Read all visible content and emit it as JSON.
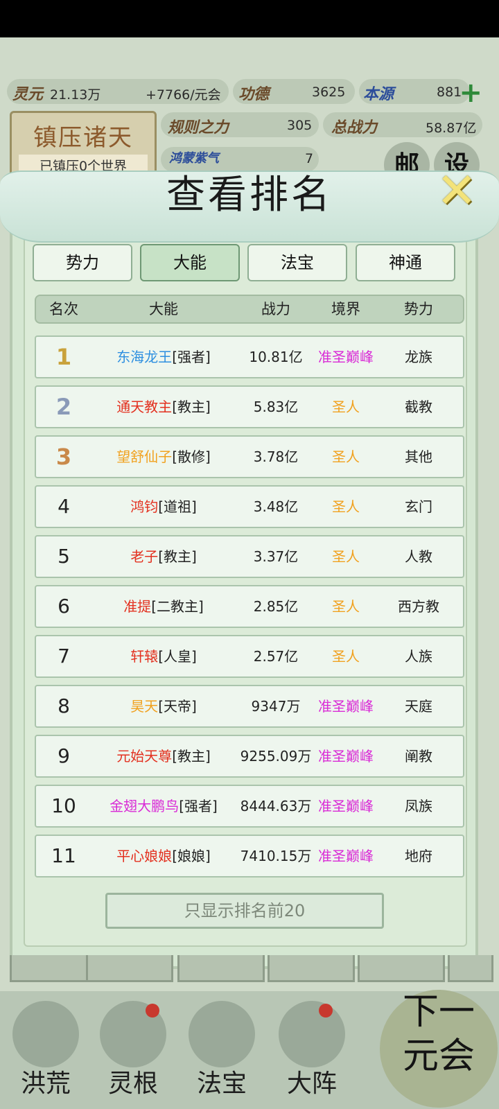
{
  "hud": {
    "lingyuan_label": "灵元",
    "lingyuan_value": "21.13万",
    "lingyuan_rate": "+7766/元会",
    "gongde_label": "功德",
    "gongde_value": "3625",
    "benyuan_label": "本源",
    "benyuan_value": "881",
    "guize_label": "规则之力",
    "guize_value": "305",
    "zhanli_label": "总战力",
    "zhanli_value": "58.87亿",
    "hongmeng_label": "鸿蒙紫气",
    "hongmeng_value": "7",
    "suppress_title": "镇压诸天",
    "suppress_sub": "已镇压0个世界",
    "mail_label": "邮",
    "settings_label": "设"
  },
  "dialog": {
    "title": "查看排名",
    "tabs": [
      "势力",
      "大能",
      "法宝",
      "神通"
    ],
    "active_tab": "大能",
    "headers": [
      "名次",
      "大能",
      "战力",
      "境界",
      "势力"
    ],
    "rows": [
      {
        "rank": "1",
        "name": "东海龙王",
        "title": "[强者]",
        "power": "10.81亿",
        "realm": "准圣巅峰",
        "faction": "龙族",
        "name_color": "#2e8fe0",
        "rank_color": "#c9a23c"
      },
      {
        "rank": "2",
        "name": "通天教主",
        "title": "[教主]",
        "power": "5.83亿",
        "realm": "圣人",
        "faction": "截教",
        "name_color": "#e3301f",
        "rank_color": "#8a9ab8"
      },
      {
        "rank": "3",
        "name": "望舒仙子",
        "title": "[散修]",
        "power": "3.78亿",
        "realm": "圣人",
        "faction": "其他",
        "name_color": "#f1a11f",
        "rank_color": "#c9894a"
      },
      {
        "rank": "4",
        "name": "鸿钧",
        "title": "[道祖]",
        "power": "3.48亿",
        "realm": "圣人",
        "faction": "玄门",
        "name_color": "#e3301f",
        "rank_color": "#222222"
      },
      {
        "rank": "5",
        "name": "老子",
        "title": "[教主]",
        "power": "3.37亿",
        "realm": "圣人",
        "faction": "人教",
        "name_color": "#e3301f",
        "rank_color": "#222222"
      },
      {
        "rank": "6",
        "name": "准提",
        "title": "[二教主]",
        "power": "2.85亿",
        "realm": "圣人",
        "faction": "西方教",
        "name_color": "#e3301f",
        "rank_color": "#222222"
      },
      {
        "rank": "7",
        "name": "轩辕",
        "title": "[人皇]",
        "power": "2.57亿",
        "realm": "圣人",
        "faction": "人族",
        "name_color": "#e3301f",
        "rank_color": "#222222"
      },
      {
        "rank": "8",
        "name": "昊天",
        "title": "[天帝]",
        "power": "9347万",
        "realm": "准圣巅峰",
        "faction": "天庭",
        "name_color": "#f1a11f",
        "rank_color": "#222222"
      },
      {
        "rank": "9",
        "name": "元始天尊",
        "title": "[教主]",
        "power": "9255.09万",
        "realm": "准圣巅峰",
        "faction": "阐教",
        "name_color": "#e3301f",
        "rank_color": "#222222"
      },
      {
        "rank": "10",
        "name": "金翅大鹏鸟",
        "title": "[强者]",
        "power": "8444.63万",
        "realm": "准圣巅峰",
        "faction": "凤族",
        "name_color": "#d92ad6",
        "rank_color": "#222222"
      },
      {
        "rank": "11",
        "name": "平心娘娘",
        "title": "[娘娘]",
        "power": "7410.15万",
        "realm": "准圣巅峰",
        "faction": "地府",
        "name_color": "#e3301f",
        "rank_color": "#222222"
      }
    ],
    "bottom_button": "只显示排名前20"
  },
  "nav": {
    "items": [
      "洪荒",
      "灵根",
      "法宝",
      "大阵"
    ],
    "next_label_1": "下一",
    "next_label_2": "元会"
  },
  "colors": {
    "realm_pink": "#d92ad6",
    "realm_orange": "#f1a11f"
  }
}
